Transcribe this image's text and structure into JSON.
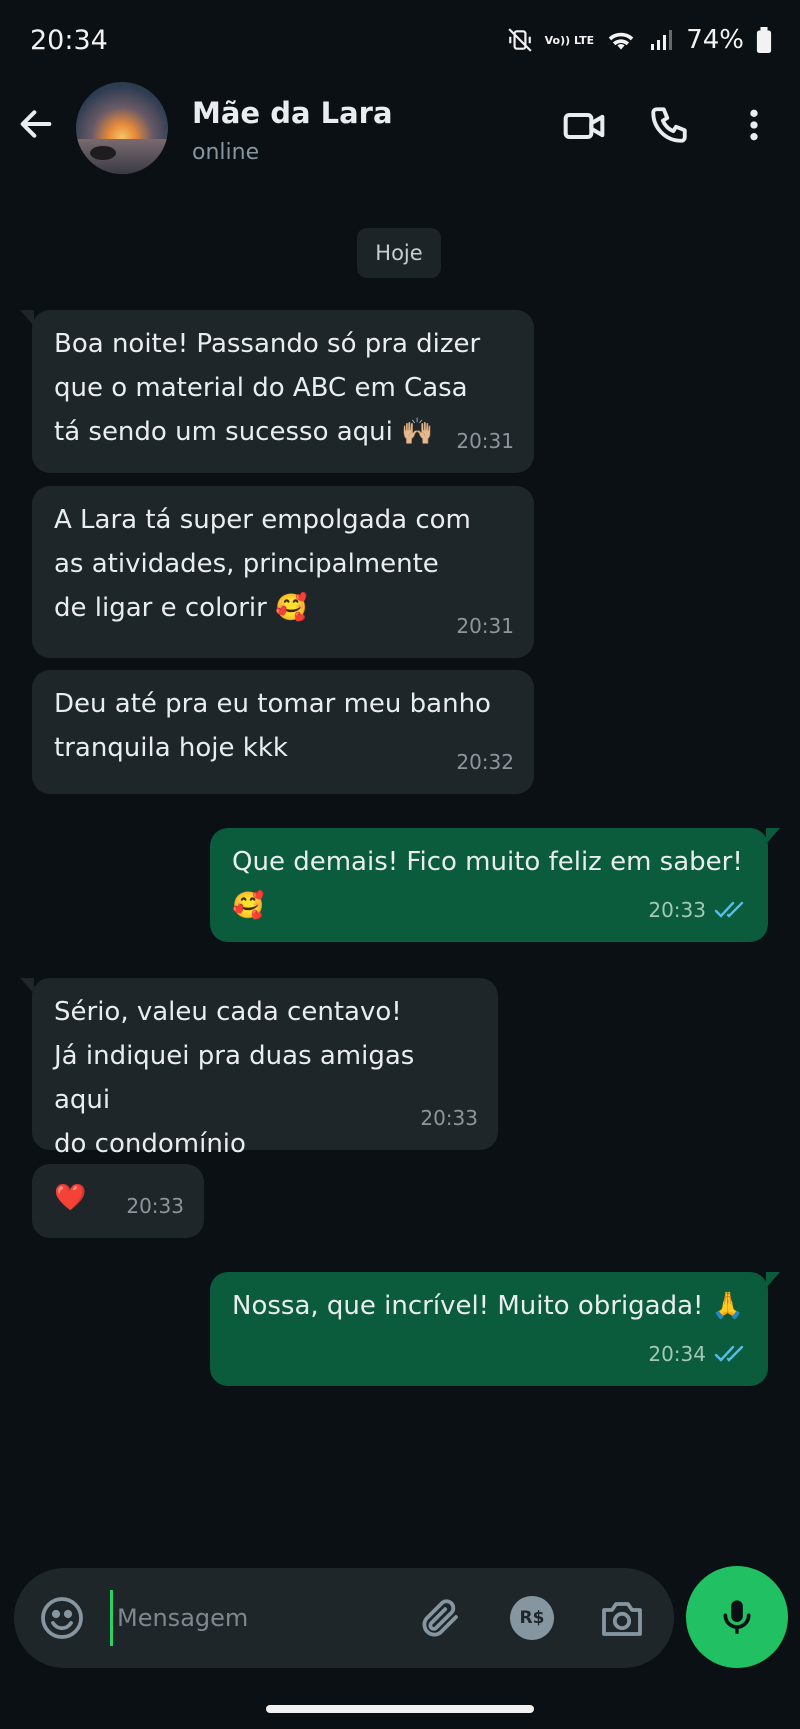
{
  "status_bar": {
    "time": "20:34",
    "network_label": "Vo)) LTE",
    "battery": "74%"
  },
  "header": {
    "contact_name": "Mãe da Lara",
    "contact_status": "online",
    "icons": [
      "back-arrow-icon",
      "video-call-icon",
      "voice-call-icon",
      "more-options-icon"
    ]
  },
  "chat": {
    "day_label": "Hoje",
    "messages": [
      {
        "direction": "in",
        "text": "Boa noite! Passando só pra dizer\nque o material do ABC em Casa\ntá sendo um sucesso aqui 🙌🏼",
        "time": "20:31"
      },
      {
        "direction": "in",
        "text": "A Lara tá super empolgada com\nas atividades, principalmente\nde ligar e colorir 🥰",
        "time": "20:31"
      },
      {
        "direction": "in",
        "text": "Deu até pra eu tomar meu banho\ntranquila hoje kkk",
        "time": "20:32"
      },
      {
        "direction": "out",
        "text": "Que demais! Fico muito feliz em saber! 🥰",
        "time": "20:33",
        "read": true
      },
      {
        "direction": "in",
        "text": "Sério, valeu cada centavo!\nJá indiquei pra duas amigas aqui\ndo condomínio",
        "time": "20:33"
      },
      {
        "direction": "in",
        "text": "❤️",
        "time": "20:33"
      },
      {
        "direction": "out",
        "text": "Nossa, que incrível! Muito obrigada!  🙏",
        "time": "20:34",
        "read": true
      }
    ]
  },
  "composer": {
    "placeholder": "Mensagem",
    "icons": [
      "emoji-icon",
      "attach-icon",
      "payment-icon",
      "camera-icon",
      "mic-icon"
    ],
    "payment_label": "R$"
  },
  "colors": {
    "background": "#0b1014",
    "incoming_bubble": "#1f2629",
    "outgoing_bubble": "#0b5c3d",
    "accent": "#21c063",
    "read_ticks": "#53bdeb"
  }
}
